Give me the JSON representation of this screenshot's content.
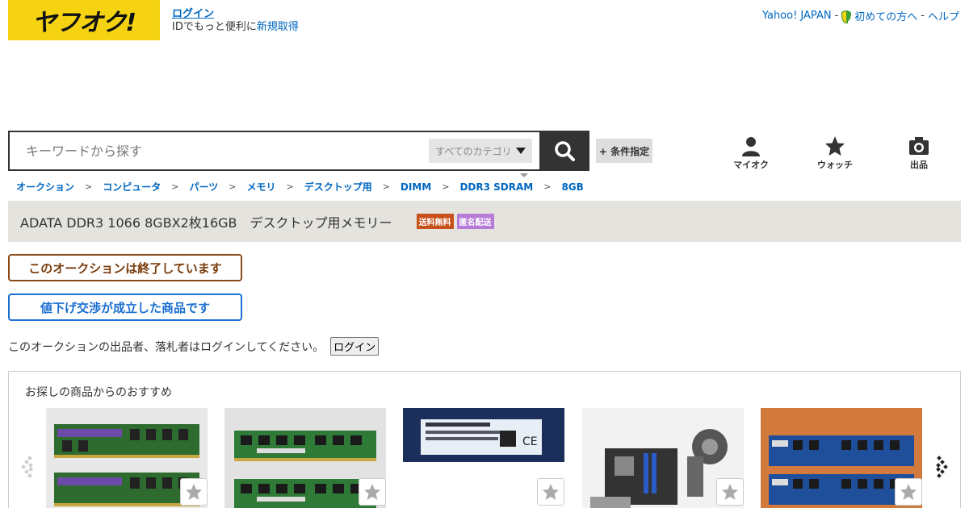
{
  "header": {
    "logo_text": "ヤフオク!",
    "login_label": "ログイン",
    "id_text": "IDでもっと便利に",
    "signup_label": "新規取得",
    "links": {
      "yahoo_japan": "Yahoo! JAPAN",
      "beginner": "初めての方へ",
      "help": "ヘルプ",
      "separator": "-"
    }
  },
  "search": {
    "placeholder": "キーワードから探す",
    "category_label": "すべてのカテゴリ",
    "condition_label": "+ 条件指定"
  },
  "nav": {
    "myauction": "マイオク",
    "watch": "ウォッチ",
    "sell": "出品"
  },
  "breadcrumb": [
    "オークション",
    "コンピュータ",
    "パーツ",
    "メモリ",
    "デスクトップ用",
    "DIMM",
    "DDR3 SDRAM",
    "8GB"
  ],
  "breadcrumb_sep": ">",
  "item": {
    "title": "ADATA DDR3 1066 8GBX2枚16GB　デスクトップ用メモリー",
    "badge_shipping": "送料無料",
    "badge_anonymous": "匿名配送"
  },
  "status": {
    "ended": "このオークションは終了しています",
    "negotiated": "値下げ交渉が成立した商品です"
  },
  "login_notice": {
    "text": "このオークションの出品者、落札者はログインしてください。",
    "button": "ログイン"
  },
  "recommend": {
    "title": "お探しの商品からのおすすめ",
    "items": [
      {
        "name": "ram-two-sticks-purple",
        "color": "#2e6b2e"
      },
      {
        "name": "ram-two-sticks-green",
        "color": "#2f7a36"
      },
      {
        "name": "ram-label-closeup",
        "color": "#1b2e5c"
      },
      {
        "name": "motherboard-with-cooler",
        "color": "#cfcfcf"
      },
      {
        "name": "ram-two-sticks-blue",
        "color": "#1f4f9a"
      }
    ]
  },
  "colors": {
    "logo_bg": "#f5d313",
    "link": "#0066c0",
    "ended_border": "#8b4a1a",
    "nego_border": "#1a6fd1",
    "badge_ship": "#c8511b",
    "badge_anon": "#b77bd8"
  }
}
